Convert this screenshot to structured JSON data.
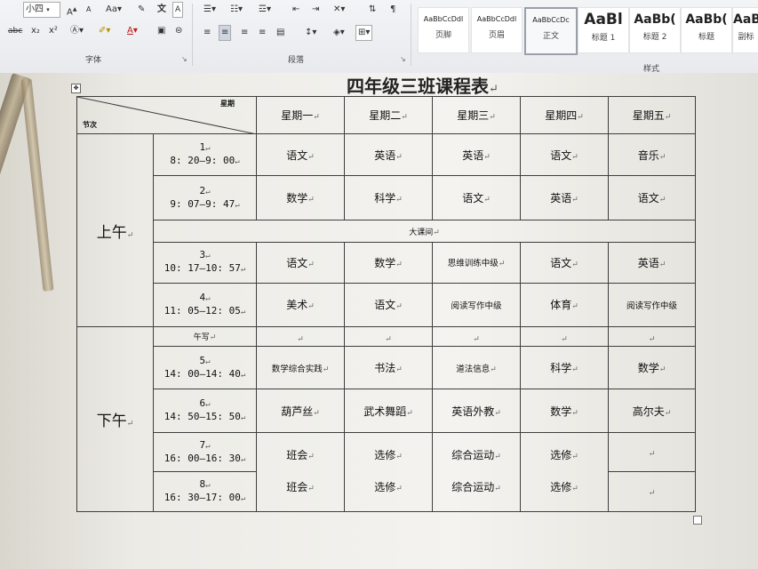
{
  "ribbon": {
    "font": {
      "size_value": "小四",
      "label": "字体",
      "buttons": [
        "A",
        "A",
        "Aa",
        "x₂",
        "x²"
      ]
    },
    "paragraph": {
      "label": "段落"
    },
    "styles": {
      "label": "样式",
      "items": [
        {
          "sample": "AaBbCcDdl",
          "name": "页脚"
        },
        {
          "sample": "AaBbCcDdl",
          "name": "页眉"
        },
        {
          "sample": "AaBbCcDc",
          "name": "正文"
        },
        {
          "sample": "AaBl",
          "name": "标题 1"
        },
        {
          "sample": "AaBb(",
          "name": "标题 2"
        },
        {
          "sample": "AaBb(",
          "name": "标题"
        },
        {
          "sample": "AaB",
          "name": "副标"
        }
      ]
    }
  },
  "document": {
    "title": "四年级三班课程表",
    "para_mark": "↵",
    "table": {
      "corner_top": "星期",
      "corner_bottom": "节次",
      "days": [
        "星期一",
        "星期二",
        "星期三",
        "星期四",
        "星期五"
      ],
      "morning_label": "上午",
      "afternoon_label": "下午",
      "break_label": "大课间",
      "noon_label": "午写",
      "periods": [
        {
          "num": "1",
          "time": "8: 20—9: 00",
          "subjects": [
            "语文",
            "英语",
            "英语",
            "语文",
            "音乐"
          ]
        },
        {
          "num": "2",
          "time": "9: 07—9: 47",
          "subjects": [
            "数学",
            "科学",
            "语文",
            "英语",
            "语文"
          ]
        },
        {
          "num": "3",
          "time": "10: 17—10: 57",
          "subjects": [
            "语文",
            "数学",
            "思维训练中级",
            "语文",
            "英语"
          ]
        },
        {
          "num": "4",
          "time": "11: 05—12: 05",
          "subjects": [
            "美术",
            "语文",
            "阅读写作中级",
            "体育",
            "阅读写作中级"
          ]
        },
        {
          "num": "5",
          "time": "14: 00—14: 40",
          "subjects": [
            "数学综合实践",
            "书法",
            "道法信息",
            "科学",
            "数学"
          ]
        },
        {
          "num": "6",
          "time": "14: 50—15: 50",
          "subjects": [
            "葫芦丝",
            "武术舞蹈",
            "英语外教",
            "数学",
            "高尔夫"
          ]
        },
        {
          "num": "7",
          "time": "16: 00—16: 30",
          "subjects": [
            "班会",
            "选修",
            "综合运动",
            "选修",
            ""
          ]
        },
        {
          "num": "8",
          "time": "16: 30—17: 00",
          "subjects": [
            "班会",
            "选修",
            "综合运动",
            "选修",
            ""
          ]
        }
      ]
    }
  }
}
